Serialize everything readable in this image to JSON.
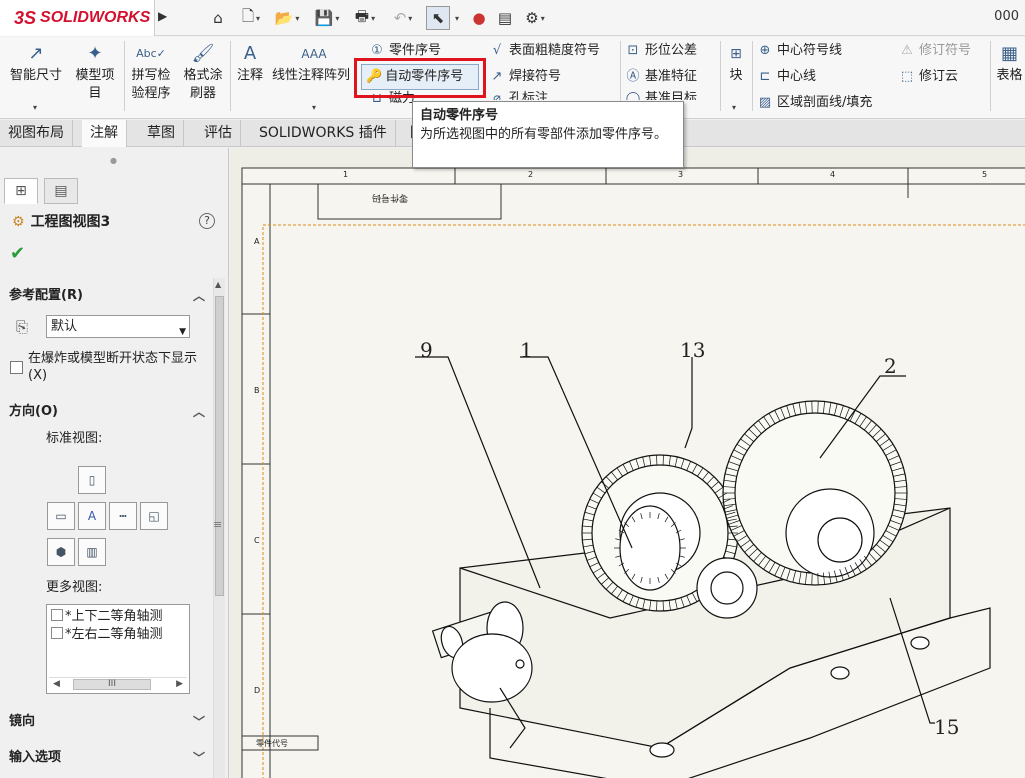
{
  "app": {
    "brand_ds": "3S",
    "brand_name": "SOLIDWORKS"
  },
  "topbar": {
    "counter": "000"
  },
  "ribbon": {
    "smart_dimension": "智能尺寸",
    "model_items": "模型项目",
    "spell_check": "拼写检验程序",
    "format_painter": "格式涂刷器",
    "note": "注释",
    "linear_note_pattern": "线性注释阵列",
    "balloon": "零件序号",
    "auto_balloon": "自动零件序号",
    "magnetic_line": "磁力",
    "surface_finish": "表面粗糙度符号",
    "weld_symbol": "焊接符号",
    "hole_callout": "孔标注",
    "geometric_tolerance": "形位公差",
    "datum_feature": "基准特征",
    "datum_target": "基准目标",
    "block": "块",
    "center_mark": "中心符号线",
    "centerline": "中心线",
    "area_hatch": "区域剖面线/填充",
    "revision_symbol": "修订符号",
    "revision_cloud": "修订云",
    "tables": "表格"
  },
  "tabs": [
    "视图布局",
    "注解",
    "草图",
    "评估",
    "SOLIDWORKS 插件",
    "图"
  ],
  "active_tab": 1,
  "tooltip": {
    "title": "自动零件序号",
    "body": "为所选视图中的所有零部件添加零件序号。"
  },
  "panel": {
    "title": "工程图视图3",
    "help": "?",
    "ref_config": {
      "title": "参考配置(R)",
      "value": "默认",
      "explode_label": "在爆炸或模型断开状态下显示(X)"
    },
    "orientation": {
      "title": "方向(O)",
      "standard_views": "标准视图:",
      "more_views": "更多视图:",
      "more_list": [
        "*上下二等角轴测",
        "*左右二等角轴测"
      ]
    },
    "mirror": "镜向",
    "import_options": "输入选项"
  },
  "drawing": {
    "title_block_text": "零件号码",
    "zone_cols": [
      "1",
      "2",
      "3",
      "4",
      "5"
    ],
    "zone_rows": [
      "A",
      "B",
      "C",
      "D"
    ],
    "side_label": "零件代号",
    "balloons": [
      "9",
      "1",
      "13",
      "2",
      "15"
    ]
  }
}
